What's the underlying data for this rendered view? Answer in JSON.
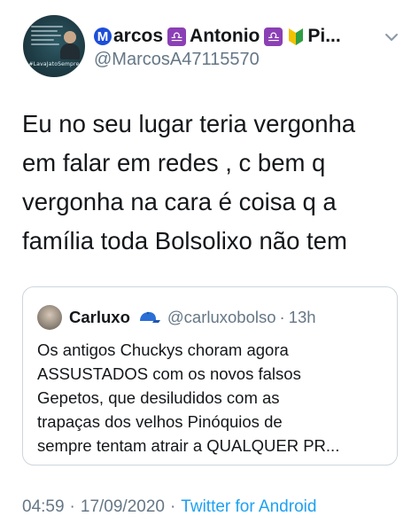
{
  "author": {
    "name_segments": [
      "arcos",
      "Antonio",
      "Pi..."
    ],
    "name_badge_letter": "M",
    "libra_glyph": "♎",
    "handle": "@MarcosA47115570",
    "avatar_caption": "#LavaJatoSempre"
  },
  "tweet": {
    "lines": [
      "Eu no seu lugar teria vergonha",
      "em falar em redes , c bem q",
      "vergonha na cara é coisa q a",
      "família toda Bolsolixo não tem"
    ]
  },
  "quoted": {
    "name": "Carluxo",
    "handle": "@carluxobolso",
    "separator": "·",
    "time": "13h",
    "lines": [
      "Os antigos Chuckys choram agora",
      "ASSUSTADOS com os novos falsos",
      "Gepetos, que desiludidos com as",
      "trapaças dos velhos Pinóquios de",
      "sempre tentam atrair a QUALQUER PR..."
    ]
  },
  "footer": {
    "time": "04:59",
    "separator": "·",
    "date": "17/09/2020",
    "app": "Twitter for Android"
  },
  "colors": {
    "text": "#14171a",
    "secondary": "#657786",
    "link": "#1da1f2",
    "border": "#cdd6dd",
    "badge_blue": "#1d4ed8",
    "libra_purple": "#8b3fb5"
  },
  "icons": [
    "m-badge-icon",
    "libra-icon",
    "beginner-symbol-icon",
    "chevron-down-icon",
    "blue-cap-icon"
  ]
}
